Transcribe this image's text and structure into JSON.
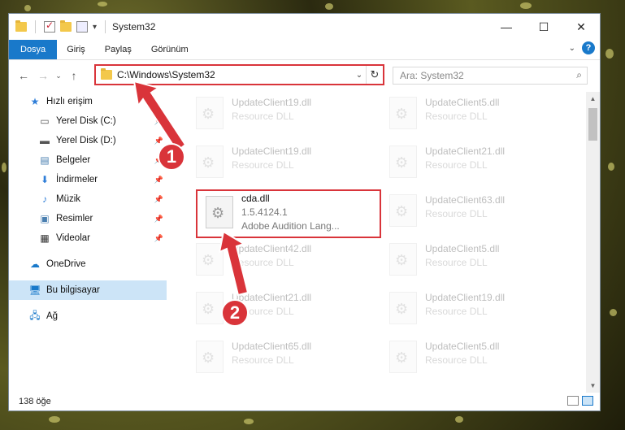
{
  "window": {
    "title": "System32",
    "controls": {
      "minimize": "—",
      "maximize": "☐",
      "close": "✕"
    }
  },
  "ribbon": {
    "tabs": [
      {
        "label": "Dosya"
      },
      {
        "label": "Giriş"
      },
      {
        "label": "Paylaş"
      },
      {
        "label": "Görünüm"
      }
    ],
    "help": "?"
  },
  "address": {
    "path": "C:\\Windows\\System32",
    "search_placeholder": "Ara: System32"
  },
  "sidebar": {
    "items": [
      {
        "label": "Hızlı erişim",
        "icon": "star-icon",
        "glyph": "★",
        "color": "#2f7ed8"
      },
      {
        "label": "Yerel Disk (C:)",
        "icon": "drive-icon",
        "glyph": "▭",
        "color": "#555"
      },
      {
        "label": "Yerel Disk (D:)",
        "icon": "drive-icon",
        "glyph": "▬",
        "color": "#555"
      },
      {
        "label": "Belgeler",
        "icon": "documents-icon",
        "glyph": "▤",
        "color": "#4a7fb0"
      },
      {
        "label": "İndirmeler",
        "icon": "download-icon",
        "glyph": "⬇",
        "color": "#2f7ed8"
      },
      {
        "label": "Müzik",
        "icon": "music-icon",
        "glyph": "♪",
        "color": "#2f7ed8"
      },
      {
        "label": "Resimler",
        "icon": "pictures-icon",
        "glyph": "▣",
        "color": "#4a7fb0"
      },
      {
        "label": "Videolar",
        "icon": "video-icon",
        "glyph": "▦",
        "color": "#333"
      },
      {
        "label": "OneDrive",
        "icon": "cloud-icon",
        "glyph": "☁",
        "color": "#1979ca"
      },
      {
        "label": "Bu bilgisayar",
        "icon": "computer-icon",
        "glyph": "▭",
        "color": "#1979ca"
      },
      {
        "label": "Ağ",
        "icon": "network-icon",
        "glyph": "⌂",
        "color": "#1979ca"
      }
    ]
  },
  "files": {
    "tiles": [
      {
        "name": "UpdateClient19.dll",
        "type": "Resource DLL"
      },
      {
        "name": "UpdateClient5.dll",
        "type": "Resource DLL"
      },
      {
        "name": "UpdateClient19.dll",
        "type": "Resource DLL"
      },
      {
        "name": "UpdateClient21.dll",
        "type": "Resource DLL"
      },
      {
        "name": "UpdateClient63.dll",
        "type": "Resource DLL"
      },
      {
        "name": "UpdateClient42.dll",
        "type": "Resource DLL"
      },
      {
        "name": "UpdateClient5.dll",
        "type": "Resource DLL"
      },
      {
        "name": "UpdateClient21.dll",
        "type": "Resource DLL"
      },
      {
        "name": "UpdateClient19.dll",
        "type": "Resource DLL"
      },
      {
        "name": "UpdateClient65.dll",
        "type": "Resource DLL"
      },
      {
        "name": "UpdateClient5.dll",
        "type": "Resource DLL"
      }
    ],
    "selected": {
      "name": "cda.dll",
      "version": "1.5.4124.1",
      "description": "Adobe Audition Lang..."
    }
  },
  "status": {
    "count": "138 öğe"
  },
  "callouts": {
    "one": "1",
    "two": "2"
  },
  "colors": {
    "accent": "#1979ca",
    "highlight": "#d9343a"
  }
}
